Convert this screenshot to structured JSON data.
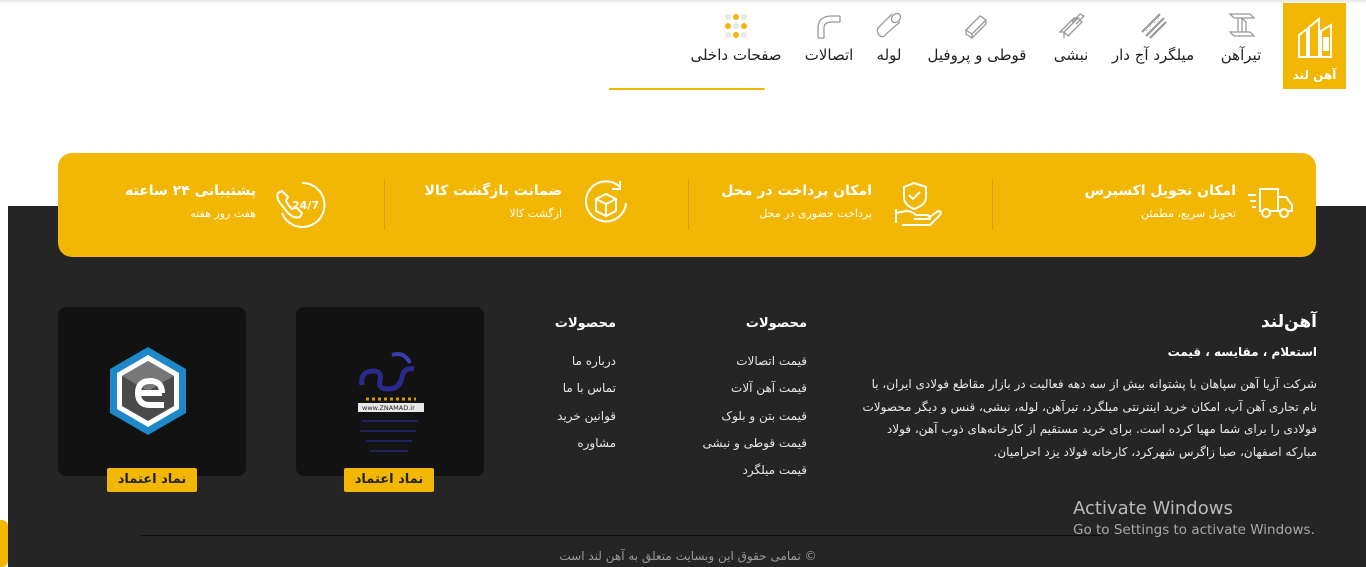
{
  "brand": {
    "name": "آهن لند",
    "color": "#f2b705"
  },
  "nav": {
    "items": [
      {
        "label": "تیرآهن",
        "icon": "i-beam-icon"
      },
      {
        "label": "میلگرد آج دار",
        "icon": "rebar-icon"
      },
      {
        "label": "نبشی",
        "icon": "angle-iron-icon"
      },
      {
        "label": "قوطی و پروفیل",
        "icon": "profile-icon"
      },
      {
        "label": "لوله",
        "icon": "pipe-icon"
      },
      {
        "label": "اتصالات",
        "icon": "elbow-fitting-icon"
      },
      {
        "label": "صفحات داخلی",
        "icon": "pages-grid-icon"
      }
    ]
  },
  "features": [
    {
      "title": "امکان تحویل اکسپرس",
      "subtitle": "تحویل سریع، مطمئن",
      "icon": "fast-truck-icon"
    },
    {
      "title": "امکان پرداخت در محل",
      "subtitle": "پرداخت حضوری در محل",
      "icon": "hand-payment-icon"
    },
    {
      "title": "ضمانت بازگشت کالا",
      "subtitle": "ازگشت کالا",
      "icon": "box-return-icon"
    },
    {
      "title": "پشتیبانی ۲۴ ساعته",
      "subtitle": "هفت روز هفته",
      "icon": "support-24-7-icon"
    }
  ],
  "about": {
    "title": "آهن‌لند",
    "subtitle": "استعلام ، مقایسه ، قیمت",
    "text": "شرکت آریا آهن سپاهان با پشتوانه بیش از سه دهه فعالیت در بازار مقاطع فولادی ایران، با نام تجاری آهن آپ، امکان خرید اینترنتی میلگرد، تیرآهن، لوله، نبشی، قنس و دیگر محصولات فولادی را برای شما مهیا کرده است. برای خرید مستقیم از کارخانه‌های ذوب آهن، فولاد مبارکه اصفهان، صبا زاگرس شهرکرد، کارخانه فولاد یزد احرامیان."
  },
  "columns": [
    {
      "title": "محصولات",
      "links": [
        "قیمت اتصالات",
        "قیمت آهن آلات",
        "قیمت بتن و بلوک",
        "قیمت قوطی و نبشی",
        "قیمت میلگرد"
      ]
    },
    {
      "title": "محصولات",
      "links": [
        "درباره ما",
        "تماس با ما",
        "قوانین خرید",
        "مشاوره"
      ]
    }
  ],
  "badges": [
    {
      "label": "نماد اعتماد",
      "icon": "samandehi-logo-icon"
    },
    {
      "label": "نماد اعتماد",
      "icon": "enamad-logo-icon"
    }
  ],
  "badge_texts": {
    "samandehi_url": "www.ZNAMAD.ir"
  },
  "copyright": "© تمامی حقوق این وبسایت متعلق به آهن لند است",
  "windows": {
    "line1": "Activate Windows",
    "line2": "Go to Settings to activate Windows."
  }
}
